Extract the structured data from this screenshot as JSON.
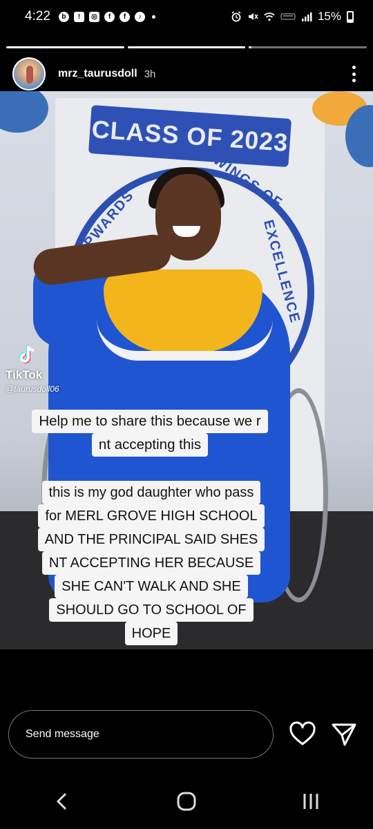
{
  "status_bar": {
    "time": "4:22",
    "battery_percent": "15%",
    "battery_level": 0.15,
    "notification_icons": [
      "b-circle-icon",
      "sim-alert-icon",
      "instagram-icon",
      "facebook-icon",
      "facebook-icon",
      "tiktok-icon"
    ],
    "notification_glyphs": [
      "b",
      "!",
      "◎",
      "f",
      "f",
      "♪"
    ],
    "right_icons": [
      "alarm-icon",
      "mute-icon",
      "wifi-icon",
      "volte-icon",
      "signal-icon"
    ]
  },
  "story": {
    "segments": [
      1,
      1,
      0.02
    ],
    "username": "mrz_taurusdoll",
    "time_ago": "3h"
  },
  "media": {
    "banner_text": "CLASS OF 2023",
    "seal_text_left": "UPWARDS",
    "seal_text_top": "WINGS OF",
    "seal_text_right": "EXCELLENCE",
    "tiktok_label": "TikTok",
    "tiktok_handle": "@taurusdoll06",
    "caption_1": [
      "Help me to share this because we r",
      "nt accepting this"
    ],
    "caption_2": [
      "this is my god daughter who pass",
      "for MERL GROVE HIGH SCHOOL",
      "AND THE PRINCIPAL SAID SHES",
      "NT ACCEPTING HER BECAUSE",
      "SHE CAN'T WALK AND SHE",
      "SHOULD GO TO SCHOOL OF",
      "HOPE"
    ]
  },
  "reply": {
    "placeholder": "Send message"
  },
  "colors": {
    "gown": "#1f55d0",
    "collar": "#f2b51c",
    "seal": "#2c4fb3"
  }
}
